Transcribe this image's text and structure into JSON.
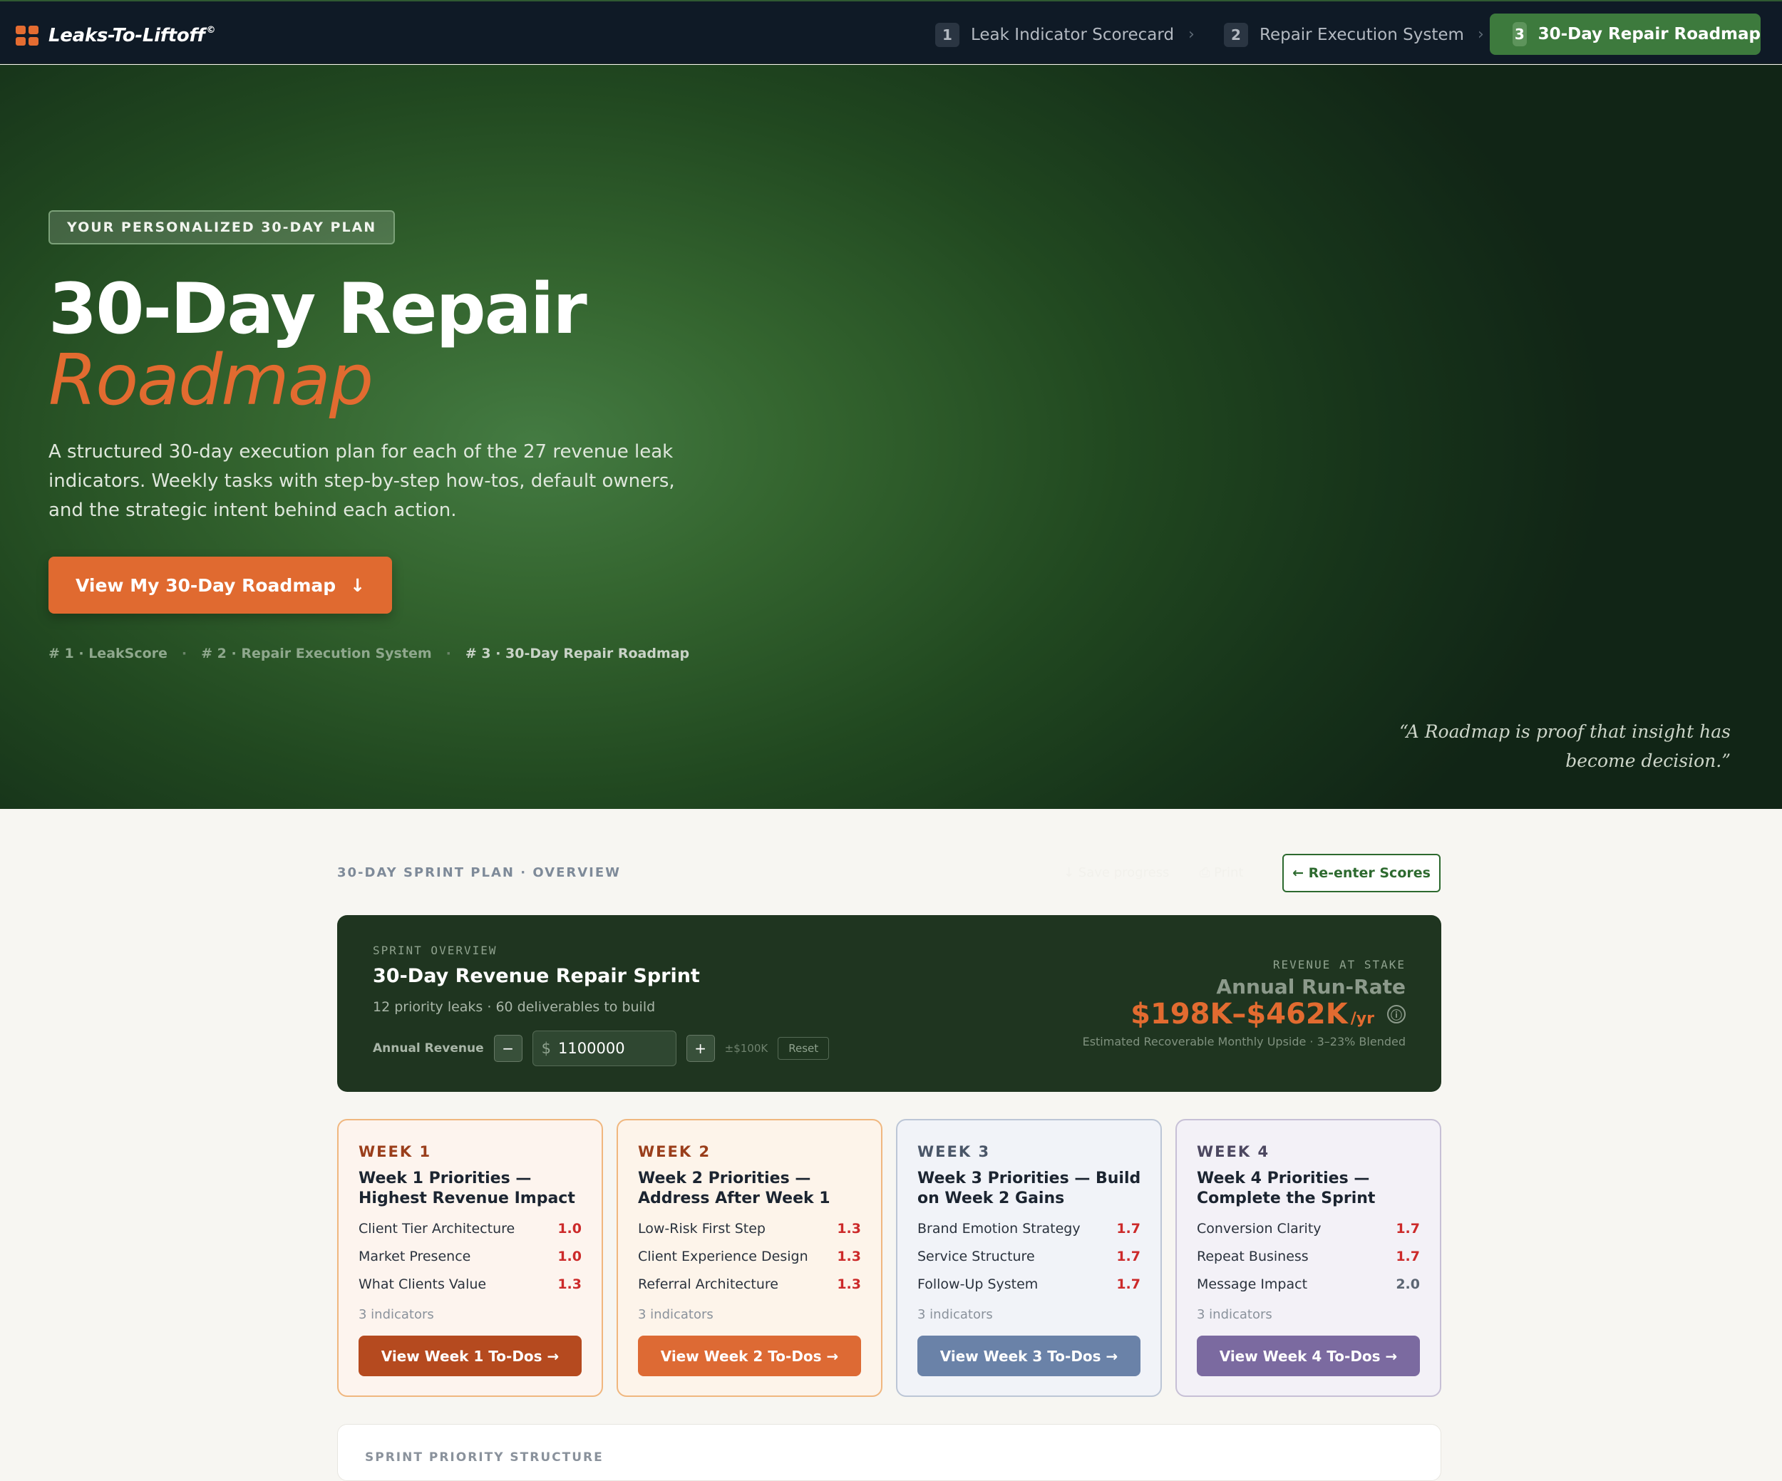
{
  "app": {
    "brand": "Leaks-To-Liftoff",
    "brand_mark": "©"
  },
  "nav": {
    "steps": [
      {
        "num": "1",
        "label": "Leak Indicator Scorecard"
      },
      {
        "num": "2",
        "label": "Repair Execution System"
      },
      {
        "num": "3",
        "label": "30-Day Repair Roadmap",
        "active": true
      }
    ],
    "separator": "›"
  },
  "hero": {
    "pill": "YOUR PERSONALIZED 30-DAY PLAN",
    "title_line1": "30-Day Repair",
    "title_line2": "Roadmap",
    "lead": "A structured 30-day execution plan for each of the 27 revenue leak indicators. Weekly tasks with step-by-step how-tos, default owners, and the strategic intent behind each action.",
    "cta": "View My 30-Day Roadmap",
    "cta_icon": "↓",
    "crumbs": [
      "# 1 · LeakScore",
      "# 2 · Repair Execution System",
      "# 3 · 30-Day Repair Roadmap"
    ],
    "crumb_sep": "·",
    "quote": "“A Roadmap is proof that insight has become decision.”"
  },
  "overview": {
    "label": "30-DAY SPRINT PLAN · OVERVIEW",
    "ghost_1": "↓ Save progress",
    "ghost_2": "⎙ Print",
    "reenter": "← Re-enter Scores"
  },
  "sprint": {
    "label": "SPRINT OVERVIEW",
    "title": "30-Day Revenue Repair Sprint",
    "subtitle": "12 priority leaks · 60 deliverables to build",
    "revenue_label": "Annual Revenue",
    "minus": "−",
    "currency": "$",
    "revenue_value": "1100000",
    "plus": "+",
    "step_hint": "±$100K",
    "reset": "Reset",
    "ras_label": "REVENUE AT STAKE",
    "ras_runrate": "Annual Run-Rate",
    "ras_value": "$198K–$462K",
    "ras_per": "/yr",
    "ras_info": "ⓘ",
    "ras_note": "Estimated Recoverable Monthly Upside · 3–23% Blended"
  },
  "weeks": [
    {
      "label": "WEEK 1",
      "title": "Week 1 Priorities — Highest Revenue Impact",
      "items": [
        {
          "name": "Client Tier Architecture",
          "score": "1.0"
        },
        {
          "name": "Market Presence",
          "score": "1.0"
        },
        {
          "name": "What Clients Value",
          "score": "1.3"
        }
      ],
      "count": "3 indicators",
      "button": "View Week 1 To-Dos →",
      "colors": {
        "border": "#f0b77f",
        "bg": "#fdf4ee",
        "label": "#9a3e1b",
        "button": "#b54a1f"
      }
    },
    {
      "label": "WEEK 2",
      "title": "Week 2 Priorities — Address After Week 1",
      "items": [
        {
          "name": "Low-Risk First Step",
          "score": "1.3"
        },
        {
          "name": "Client Experience Design",
          "score": "1.3"
        },
        {
          "name": "Referral Architecture",
          "score": "1.3"
        }
      ],
      "count": "3 indicators",
      "button": "View Week 2 To-Dos →",
      "colors": {
        "border": "#f0b77f",
        "bg": "#fdf4ea",
        "label": "#9a3e1b",
        "button": "#dd6a34"
      }
    },
    {
      "label": "WEEK 3",
      "title": "Week 3 Priorities — Build on Week 2 Gains",
      "items": [
        {
          "name": "Brand Emotion Strategy",
          "score": "1.7"
        },
        {
          "name": "Service Structure",
          "score": "1.7"
        },
        {
          "name": "Follow-Up System",
          "score": "1.7"
        }
      ],
      "count": "3 indicators",
      "button": "View Week 3 To-Dos →",
      "colors": {
        "border": "#bcc6d6",
        "bg": "#f1f3f8",
        "label": "#4a5668",
        "button": "#6a82a8"
      }
    },
    {
      "label": "WEEK 4",
      "title": "Week 4 Priorities — Complete the Sprint",
      "items": [
        {
          "name": "Conversion Clarity",
          "score": "1.7"
        },
        {
          "name": "Repeat Business",
          "score": "1.7"
        },
        {
          "name": "Message Impact",
          "score": "2.0"
        }
      ],
      "count": "3 indicators",
      "button": "View Week 4 To-Dos →",
      "colors": {
        "border": "#c7c0d6",
        "bg": "#f3f1f7",
        "label": "#4c4760",
        "button": "#7b6aa0"
      }
    }
  ],
  "bottom": {
    "label": "SPRINT PRIORITY STRUCTURE"
  },
  "colors": {
    "nav_bg": "#0f1a26",
    "active_step": "#3d7a3d",
    "accent_orange": "#e06a30",
    "sprint_bg": "#1f3520",
    "page_bg": "#f7f6f2"
  }
}
